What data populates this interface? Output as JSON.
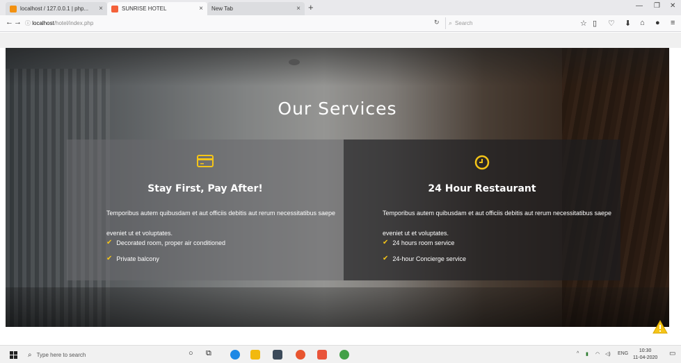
{
  "browser": {
    "tabs": [
      {
        "title": "localhost / 127.0.0.1 | php..."
      },
      {
        "title": "SUNRISE HOTEL"
      },
      {
        "title": "New Tab"
      }
    ],
    "url_host": "localhost",
    "url_path": "/hotel/index.php",
    "search_placeholder": "Search"
  },
  "page": {
    "heading": "Our Services",
    "cards": [
      {
        "title": "Stay First, Pay After!",
        "description": "Temporibus autem quibusdam et aut officiis debitis aut rerum necessitatibus saepe eveniet ut et voluptates.",
        "features": [
          "Decorated room, proper air conditioned",
          "Private balcony"
        ]
      },
      {
        "title": "24 Hour Restaurant",
        "description": "Temporibus autem quibusdam et aut officiis debitis aut rerum necessitatibus saepe eveniet ut et voluptates.",
        "features": [
          "24 hours room service",
          "24-hour Concierge service"
        ]
      }
    ],
    "accent_color": "#f5c518"
  },
  "taskbar": {
    "search_placeholder": "Type here to search",
    "language": "ENG",
    "time": "10:30",
    "date": "11-04-2020"
  }
}
